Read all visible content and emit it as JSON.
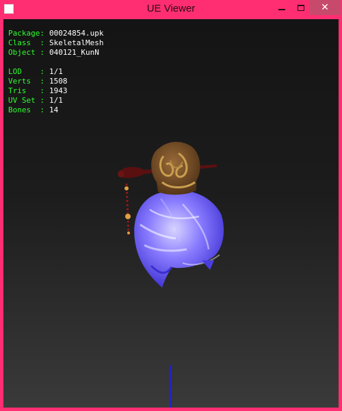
{
  "window": {
    "title": "UE Viewer",
    "close_glyph": "✕"
  },
  "info": {
    "package_label": "Package:",
    "package_value": "00024854.upk",
    "class_label": "Class  :",
    "class_value": "SkeletalMesh",
    "object_label": "Object :",
    "object_value": "040121_KunN",
    "lod_label": "LOD    :",
    "lod_value": "1/1",
    "verts_label": "Verts  :",
    "verts_value": "1508",
    "tris_label": "Tris   :",
    "tris_value": "1943",
    "uvset_label": "UV Set :",
    "uvset_value": "1/1",
    "bones_label": "Bones  :",
    "bones_value": "14"
  },
  "icons": {
    "app": "app-window-icon",
    "minimize": "minimize-icon",
    "maximize": "maximize-icon",
    "close": "close-icon"
  },
  "colors": {
    "window_frame": "#ff2e72",
    "close_button": "#c74a6c",
    "label_green": "#2fff2f",
    "value_white": "#ffffff",
    "hair_purple": "#6a5cf0",
    "bun_brown": "#7a5028",
    "axis_blue": "#1a1aff"
  }
}
